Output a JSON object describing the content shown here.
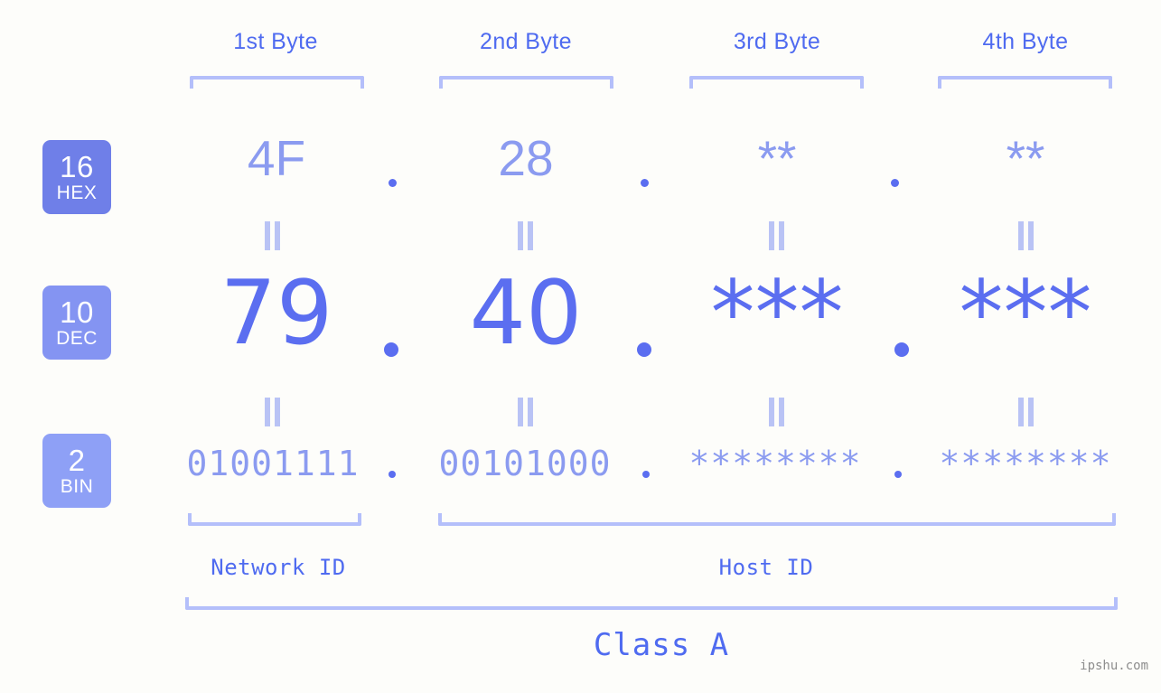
{
  "theme": {
    "background": "#fdfdfa",
    "accent_strong": "#5b6ef0",
    "accent_header": "#4f6bf0",
    "accent_light": "#8b9bf0",
    "bracket": "#b4bffa",
    "eq_mark": "#b9c3f5",
    "badge_hex": "#6f7fe8",
    "badge_dec": "#8494f2",
    "badge_bin": "#8ea0f6",
    "watermark": "#8d8d8d"
  },
  "headers": [
    {
      "label": "1st Byte"
    },
    {
      "label": "2nd Byte"
    },
    {
      "label": "3rd Byte"
    },
    {
      "label": "4th Byte"
    }
  ],
  "bases": [
    {
      "num": "16",
      "abbr": "HEX"
    },
    {
      "num": "10",
      "abbr": "DEC"
    },
    {
      "num": "2",
      "abbr": "BIN"
    }
  ],
  "rows": {
    "hex": {
      "base": "16",
      "abbr": "HEX",
      "values": [
        "4F",
        "28",
        "**",
        "**"
      ],
      "separator": "."
    },
    "dec": {
      "base": "10",
      "abbr": "DEC",
      "values": [
        "79",
        "40",
        "***",
        "***"
      ],
      "separator": "."
    },
    "bin": {
      "base": "2",
      "abbr": "BIN",
      "values": [
        "01001111",
        "00101000",
        "********",
        "********"
      ],
      "separator": "."
    }
  },
  "equals_symbol": "=",
  "footer": {
    "network_id_label": "Network ID",
    "host_id_label": "Host ID",
    "class_label": "Class A",
    "watermark": "ipshu.com"
  }
}
